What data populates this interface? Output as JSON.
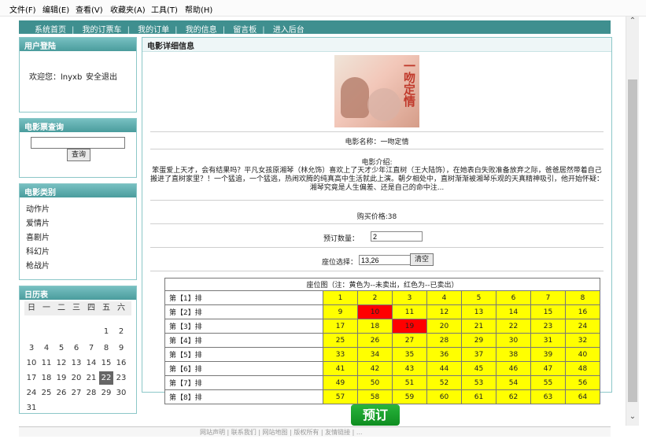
{
  "menu": [
    "文件(F)",
    "编辑(E)",
    "查看(V)",
    "收藏夹(A)",
    "工具(T)",
    "帮助(H)"
  ],
  "nav": [
    "系统首页",
    "我的订票车",
    "我的订单",
    "我的信息",
    "留言板",
    "进入后台"
  ],
  "login": {
    "title": "用户登陆",
    "welcome": "欢迎您：lnyxb",
    "logout": "安全退出"
  },
  "ticket_query": {
    "title": "电影票查询",
    "query_value": "",
    "button": "查询"
  },
  "category": {
    "title": "电影类别",
    "items": [
      "动作片",
      "爱情片",
      "喜剧片",
      "科幻片",
      "枪战片"
    ]
  },
  "calendar": {
    "title": "日历表",
    "weekdays": [
      "日",
      "一",
      "二",
      "三",
      "四",
      "五",
      "六"
    ],
    "days": [
      "1",
      "2",
      "3",
      "4",
      "5",
      "6",
      "7",
      "8",
      "9",
      "10",
      "11",
      "12",
      "13",
      "14",
      "15",
      "16",
      "17",
      "18",
      "19",
      "20",
      "21",
      "22",
      "23",
      "24",
      "25",
      "26",
      "27",
      "28",
      "29",
      "30",
      "31"
    ],
    "today": "22"
  },
  "detail": {
    "title": "电影详细信息",
    "poster_title": "一吻定情",
    "movie_name": "电影名称：一吻定情",
    "intro_label": "电影介绍:",
    "intro_text": "笨蛋爱上天才，会有结果吗？平凡女孩原湘琴（林允饰）喜欢上了天才少年江直树（王大陆饰），在她表白失败准备放弃之际，爸爸居然带着自己搬进了直树家里？！一个猛追，一个猛逃，热闹欢腾的纯真高中生活就此上演。朝夕相处中，直树渐渐被湘琴乐观的天真精神吸引，他开始怀疑：湘琴究竟是人生偏差、还是自己的命中注...",
    "price": "购买价格:38",
    "qty_label": "预订数量：",
    "qty_value": "2",
    "seat_label": "座位选择：",
    "seat_value": "13,26",
    "clear_button": "清空",
    "seat_caption": "座位图（注：黄色为--未卖出，红色为--已卖出）",
    "rows": [
      "第【1】排",
      "第【2】排",
      "第【3】排",
      "第【4】排",
      "第【5】排",
      "第【6】排",
      "第【7】排",
      "第【8】排"
    ],
    "sold": [
      "10",
      "19"
    ],
    "book_button": "预订"
  },
  "footer": "网站声明 | 联系我们 | 网站地图 | 版权所有 | 友情链接 | ..."
}
